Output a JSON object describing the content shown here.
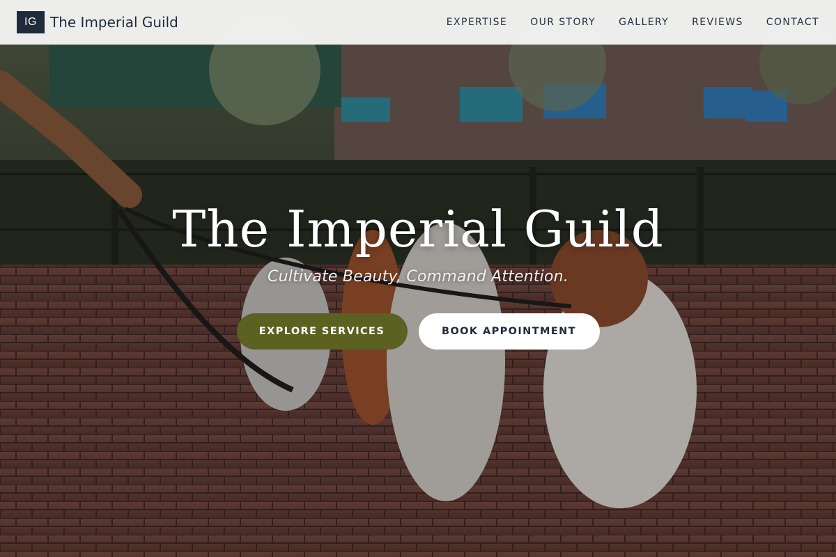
{
  "header": {
    "logo_text": "IG",
    "brand_name": "The Imperial Guild",
    "nav": [
      {
        "label": "EXPERTISE"
      },
      {
        "label": "OUR STORY"
      },
      {
        "label": "GALLERY"
      },
      {
        "label": "REVIEWS"
      },
      {
        "label": "CONTACT"
      }
    ]
  },
  "hero": {
    "title": "The Imperial Guild",
    "subtitle": "Cultivate Beauty, Command Attention.",
    "primary_button": "EXPLORE SERVICES",
    "secondary_button": "BOOK APPOINTMENT",
    "background_image": "dogs-on-leash-in-park-photo"
  },
  "colors": {
    "logo_bg": "#1f2a3a",
    "primary_button": "#5b6121",
    "secondary_button": "#ffffff",
    "navbar_bg": "#f5f5f4"
  }
}
